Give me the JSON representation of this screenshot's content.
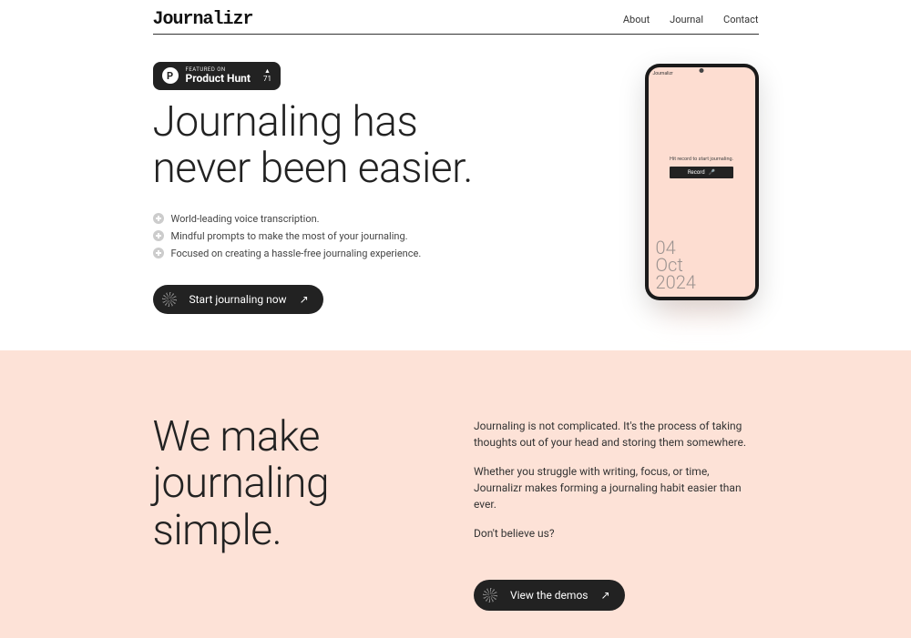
{
  "brand": "Journalizr",
  "nav": {
    "about": "About",
    "journal": "Journal",
    "contact": "Contact"
  },
  "ph": {
    "featured": "FEATURED ON",
    "name": "Product Hunt",
    "count": "71"
  },
  "hero": {
    "title_l1": "Journaling has",
    "title_l2": "never been easier.",
    "bullets": [
      "World-leading voice transcription.",
      "Mindful prompts to make the most of your journaling.",
      "Focused on creating a hassle-free journaling experience."
    ],
    "cta": "Start journaling now"
  },
  "phone": {
    "brand": "Journalizr",
    "hint": "Hit record to start journaling.",
    "record": "Record",
    "date": {
      "day": "04",
      "month": "Oct",
      "year": "2024"
    }
  },
  "section2": {
    "title_l1": "We make",
    "title_l2": "journaling",
    "title_l3": "simple.",
    "p1": "Journaling is not complicated. It's the process of taking thoughts out of your head and storing them somewhere.",
    "p2": "Whether you struggle with writing, focus, or time, Journalizr makes forming a journaling habit easier than ever.",
    "p3": "Don't believe us?",
    "cta": "View the demos"
  }
}
